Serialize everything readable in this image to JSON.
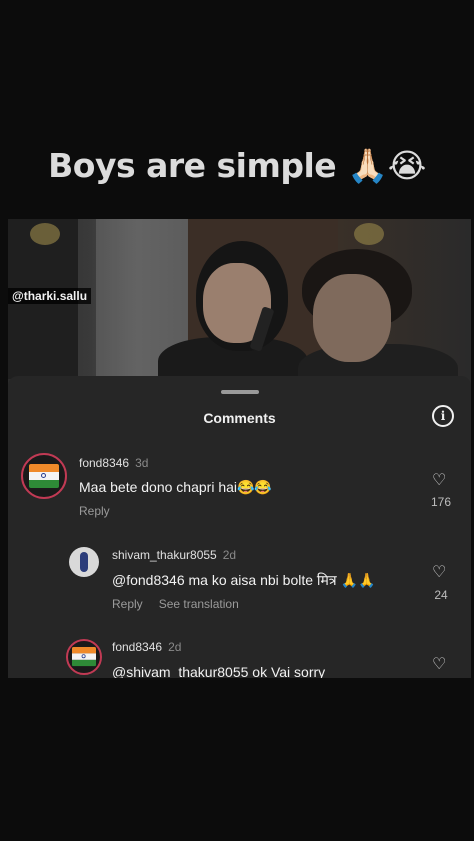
{
  "overlay": {
    "caption": "Boys are simple 🙏🏻😭"
  },
  "video": {
    "watermark": "@tharki.sallu"
  },
  "comments_sheet": {
    "title": "Comments",
    "info_icon": "info-icon",
    "comments": [
      {
        "username": "fond8346",
        "age": "3d",
        "text": "Maa bete dono chapri hai😂😂",
        "reply_label": "Reply",
        "likes": "176",
        "avatar": "india-flag"
      },
      {
        "username": "shivam_thakur8055",
        "age": "2d",
        "text": "@fond8346 ma ko aisa nbi bolte मित्र 🙏🙏",
        "reply_label": "Reply",
        "translate_label": "See translation",
        "likes": "24",
        "avatar": "profile-photo"
      },
      {
        "username": "fond8346",
        "age": "2d",
        "text": "@shivam_thakur8055 ok Vai sorry",
        "avatar": "india-flag"
      }
    ]
  },
  "colors": {
    "background": "#0c0c0c",
    "sheet": "#262626",
    "avatar_ring": "#c13a54"
  }
}
